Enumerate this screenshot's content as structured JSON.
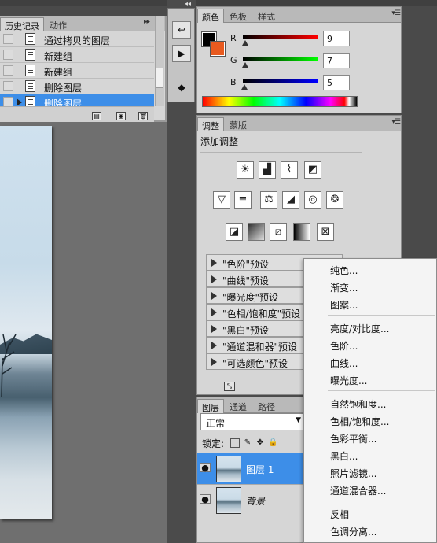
{
  "history_panel": {
    "tabs": [
      "历史记录",
      "动作"
    ],
    "items": [
      {
        "label": "通过拷贝的图层",
        "selected": false
      },
      {
        "label": "新建组",
        "selected": false
      },
      {
        "label": "新建组",
        "selected": false
      },
      {
        "label": "删除图层",
        "selected": false
      },
      {
        "label": "删除图层",
        "selected": true
      }
    ]
  },
  "color_panel": {
    "tabs": [
      "颜色",
      "色板",
      "样式"
    ],
    "foreground": "#000000",
    "background": "#e85a1f",
    "channels": [
      {
        "label": "R",
        "value": "9",
        "fraction": 0.035,
        "gradient": [
          "#000000",
          "#ff0000"
        ]
      },
      {
        "label": "G",
        "value": "7",
        "fraction": 0.027,
        "gradient": [
          "#000000",
          "#00ff00"
        ]
      },
      {
        "label": "B",
        "value": "5",
        "fraction": 0.02,
        "gradient": [
          "#000000",
          "#0000ff"
        ]
      }
    ]
  },
  "adjustments_panel": {
    "tabs": [
      "调整",
      "蒙版"
    ],
    "title": "添加调整",
    "presets": [
      "\"色阶\"预设",
      "\"曲线\"预设",
      "\"曝光度\"预设",
      "\"色相/饱和度\"预设",
      "\"黑白\"预设",
      "\"通道混和器\"预设",
      "\"可选颜色\"预设"
    ]
  },
  "layers_panel": {
    "tabs": [
      "图层",
      "通道",
      "路径"
    ],
    "blend_mode": "正常",
    "lock_label": "锁定:",
    "layers": [
      {
        "name": "图层 1",
        "selected": true
      },
      {
        "name": "背景",
        "selected": false
      }
    ]
  },
  "context_menu": {
    "groups": [
      [
        "纯色...",
        "渐变...",
        "图案..."
      ],
      [
        "亮度/对比度...",
        "色阶...",
        "曲线...",
        "曝光度..."
      ],
      [
        "自然饱和度...",
        "色相/饱和度...",
        "色彩平衡...",
        "黑白...",
        "照片滤镜...",
        "通道混合器..."
      ],
      [
        "反相",
        "色调分离..."
      ]
    ]
  },
  "accent_color": "#3d8ee8"
}
